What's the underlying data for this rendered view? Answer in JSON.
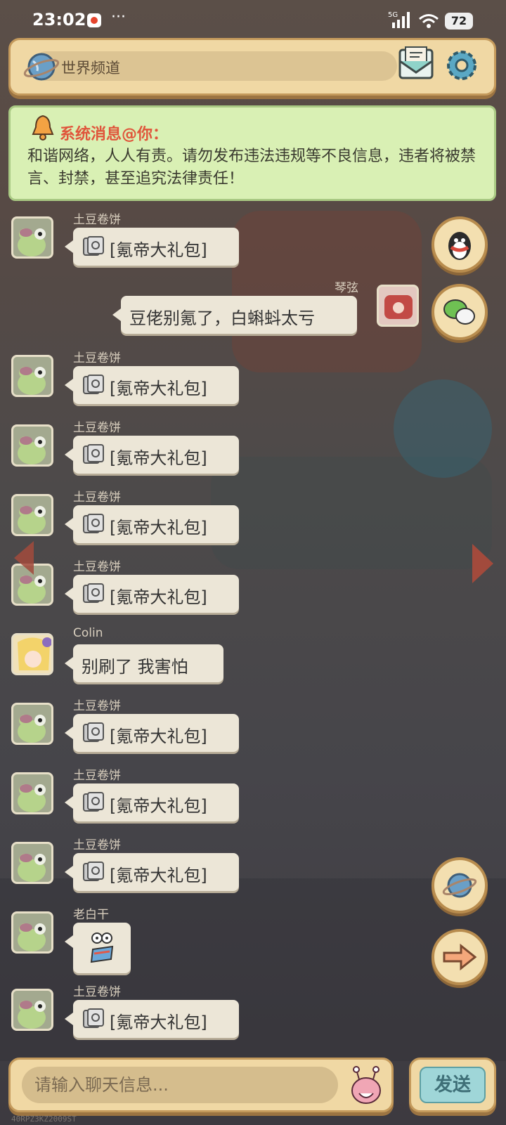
{
  "status_bar": {
    "time": "23:02",
    "more": "···",
    "network": "5G",
    "battery": "72"
  },
  "header": {
    "channel": "世界频道"
  },
  "notice": {
    "title": "系统消息@你：",
    "body": "和谐网络，人人有责。请勿发布违法违规等不良信息，违者将被禁言、封禁，甚至追究法律责任！"
  },
  "messages": [
    {
      "sender": "土豆卷饼",
      "text": "[氪帝大礼包]",
      "type": "gift"
    },
    {
      "sender": "琴弦",
      "text": "豆佬别氪了，白蝌蚪太亏",
      "type": "text",
      "self": true
    },
    {
      "sender": "土豆卷饼",
      "text": "[氪帝大礼包]",
      "type": "gift"
    },
    {
      "sender": "土豆卷饼",
      "text": "[氪帝大礼包]",
      "type": "gift"
    },
    {
      "sender": "土豆卷饼",
      "text": "[氪帝大礼包]",
      "type": "gift"
    },
    {
      "sender": "土豆卷饼",
      "text": "[氪帝大礼包]",
      "type": "gift"
    },
    {
      "sender": "Colin",
      "text": "别刷了  我害怕",
      "type": "text"
    },
    {
      "sender": "土豆卷饼",
      "text": "[氪帝大礼包]",
      "type": "gift"
    },
    {
      "sender": "土豆卷饼",
      "text": "[氪帝大礼包]",
      "type": "gift"
    },
    {
      "sender": "土豆卷饼",
      "text": "[氪帝大礼包]",
      "type": "gift"
    },
    {
      "sender": "老白干",
      "text": "",
      "type": "sticker"
    },
    {
      "sender": "土豆卷饼",
      "text": "[氪帝大礼包]",
      "type": "gift"
    }
  ],
  "input": {
    "placeholder": "请输入聊天信息..."
  },
  "send_button": {
    "label": "发送"
  },
  "watermark": "40RPZ3KZ2009ST"
}
